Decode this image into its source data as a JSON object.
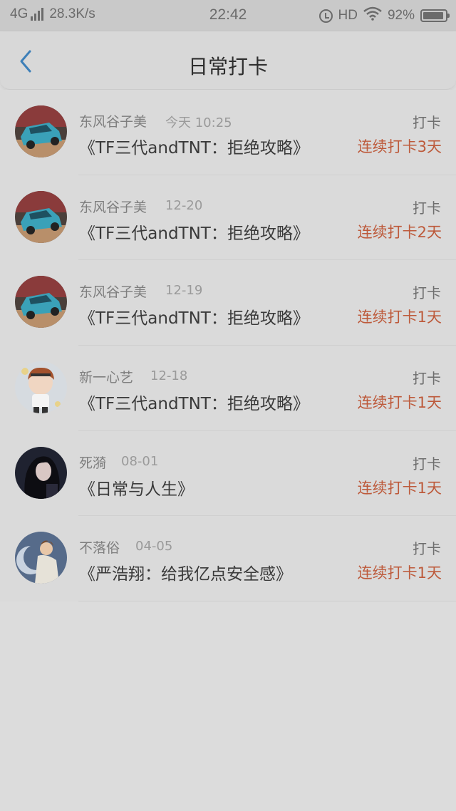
{
  "status_bar": {
    "network": "4G",
    "speed": "28.3K/s",
    "time": "22:42",
    "hd": "HD",
    "battery": "92%",
    "battery_level": 0.92
  },
  "nav": {
    "title": "日常打卡",
    "back_icon": "chevron-left-icon"
  },
  "colors": {
    "streak": "#bd5a3b",
    "back_icon": "#3d7fb8"
  },
  "checkins": [
    {
      "user": "东风谷子美",
      "date": "今天 10:25",
      "title": "《TF三代andTNT：拒绝攻略》",
      "action": "打卡",
      "streak": "连续打卡3天",
      "avatar": "car-avatar"
    },
    {
      "user": "东风谷子美",
      "date": "12-20",
      "title": "《TF三代andTNT：拒绝攻略》",
      "action": "打卡",
      "streak": "连续打卡2天",
      "avatar": "car-avatar"
    },
    {
      "user": "东风谷子美",
      "date": "12-19",
      "title": "《TF三代andTNT：拒绝攻略》",
      "action": "打卡",
      "streak": "连续打卡1天",
      "avatar": "car-avatar"
    },
    {
      "user": "新一心艺",
      "date": "12-18",
      "title": "《TF三代andTNT：拒绝攻略》",
      "action": "打卡",
      "streak": "连续打卡1天",
      "avatar": "cartoon-boy-avatar"
    },
    {
      "user": "死漪",
      "date": "08-01",
      "title": "《日常与人生》",
      "action": "打卡",
      "streak": "连续打卡1天",
      "avatar": "girl-portrait-avatar"
    },
    {
      "user": "不落俗",
      "date": "04-05",
      "title": "《严浩翔：给我亿点安全感》",
      "action": "打卡",
      "streak": "连续打卡1天",
      "avatar": "moon-art-avatar"
    }
  ]
}
